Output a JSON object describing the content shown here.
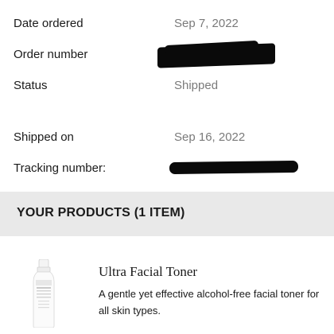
{
  "order": {
    "date_ordered_label": "Date ordered",
    "date_ordered_value": "Sep 7, 2022",
    "order_number_label": "Order number",
    "status_label": "Status",
    "status_value": "Shipped",
    "shipped_on_label": "Shipped on",
    "shipped_on_value": "Sep 16, 2022",
    "tracking_label": "Tracking number:"
  },
  "products_section": {
    "title": "YOUR PRODUCTS (1 ITEM)"
  },
  "products": [
    {
      "name": "Ultra Facial Toner",
      "description": "A gentle yet effective alcohol-free facial toner for all skin types."
    }
  ],
  "colors": {
    "label_text": "#1a1a1a",
    "value_text": "#7a7a7a",
    "section_band": "#e9e9e9",
    "redaction": "#0a0a0a"
  }
}
